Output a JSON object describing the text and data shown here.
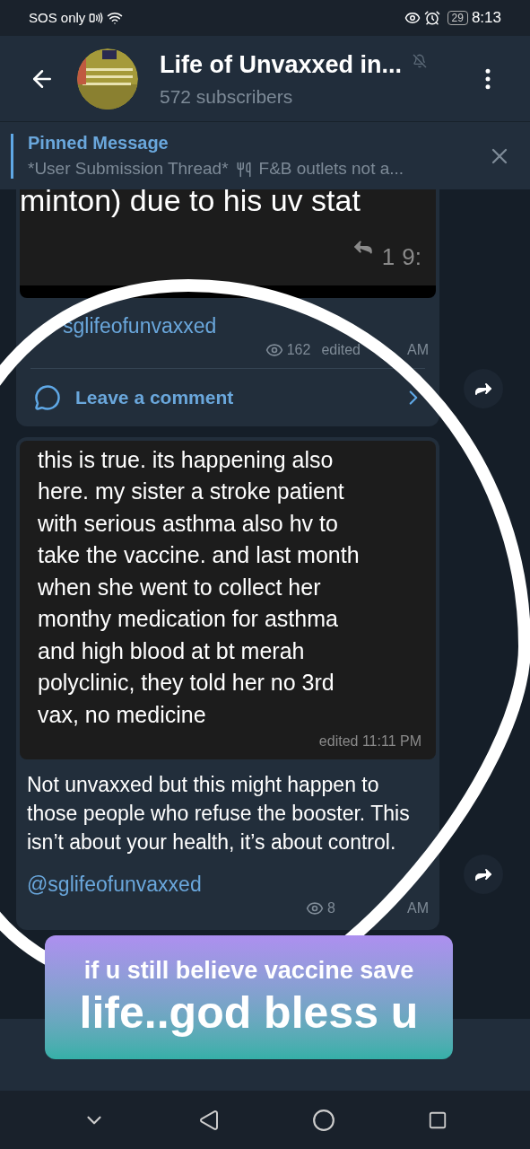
{
  "status_bar": {
    "carrier": "SOS only",
    "battery": "29",
    "time": "8:13"
  },
  "header": {
    "title": "Life of Unvaxxed in...",
    "subtitle": "572 subscribers",
    "muted": true
  },
  "pinned": {
    "label": "Pinned Message",
    "text": "*User Submission Thread*",
    "text_2": "F&B outlets not a..."
  },
  "messages": [
    {
      "image_lines": [
        "minton) due to his uv stat"
      ],
      "image_replies": "1",
      "image_time": "9:",
      "link": "sglifeofunvaxxed",
      "views": "162",
      "edited": "edited",
      "time": "AM",
      "comment": "Leave a comment"
    },
    {
      "image_lines": [
        "this is true. its happening also",
        "here. my sister a stroke patient",
        "with serious asthma  also hv to",
        "take the vaccine. and  last month",
        "when she went to collect her",
        "monthy medication for asthma",
        "and high blood at bt merah",
        "polyclinic, they told her no 3rd",
        "vax, no medicine"
      ],
      "image_time": "edited 11:11 PM",
      "caption": "Not unvaxxed but this might happen to those people who refuse the booster. This isn’t about your health, it’s about control.",
      "link": "@sglifeofunvaxxed",
      "views": "8",
      "time": "AM"
    }
  ],
  "sticker": {
    "line_1": "if u still believe vaccine save",
    "line_2": "life..god bless u"
  }
}
